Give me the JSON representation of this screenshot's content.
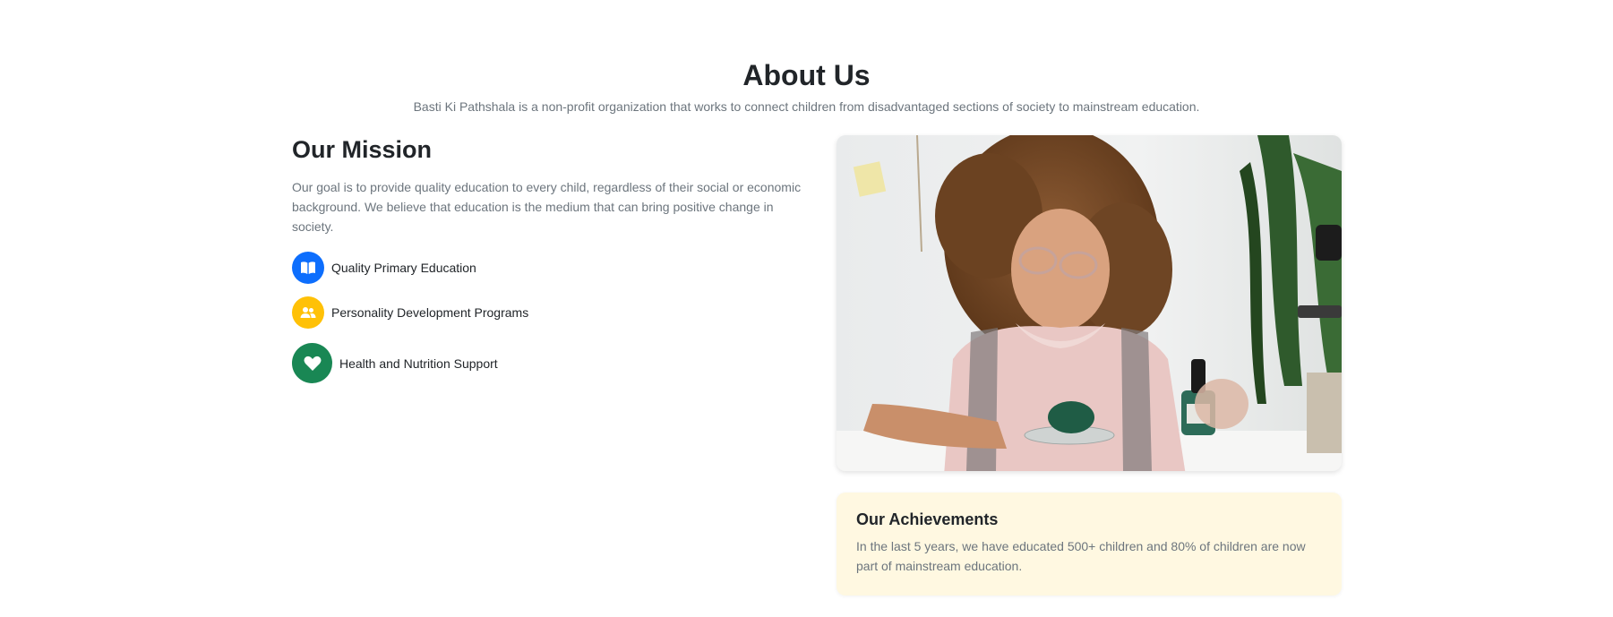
{
  "about": {
    "title": "About Us",
    "subtitle": "Basti Ki Pathshala is a non-profit organization that works to connect children from disadvantaged sections of society to mainstream education."
  },
  "mission": {
    "heading": "Our Mission",
    "text": "Our goal is to provide quality education to every child, regardless of their social or economic background. We believe that education is the medium that can bring positive change in society.",
    "features": [
      {
        "icon": "book-icon",
        "label": "Quality Primary Education",
        "color": "#0d6efd"
      },
      {
        "icon": "people-icon",
        "label": "Personality Development Programs",
        "color": "#ffc107"
      },
      {
        "icon": "heart-icon",
        "label": "Health and Nutrition Support",
        "color": "#198754"
      }
    ]
  },
  "photo": {
    "subject": "girl-with-glasses-doing-science-experiment"
  },
  "achievements": {
    "title": "Our Achievements",
    "text": "In the last 5 years, we have educated 500+ children and 80% of children are now part of mainstream education.",
    "background": "#fff8e1"
  }
}
